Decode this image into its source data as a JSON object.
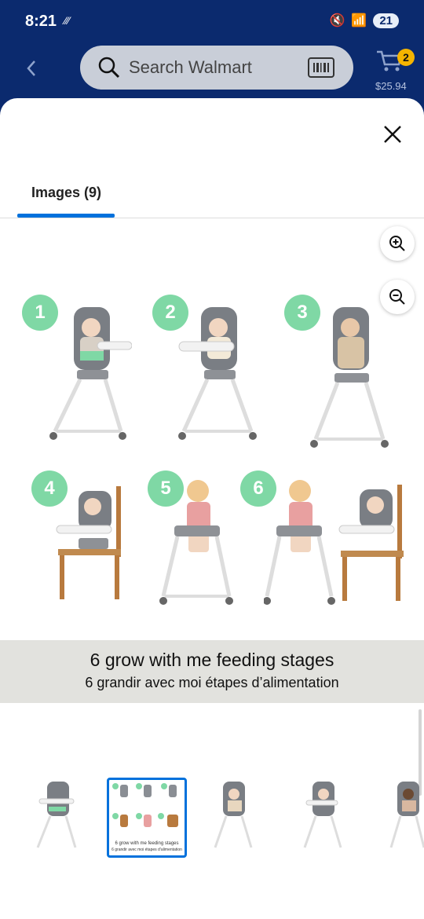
{
  "status_bar": {
    "time": "8:21",
    "battery": "21"
  },
  "search": {
    "placeholder": "Search Walmart"
  },
  "cart": {
    "count": "2",
    "total": "$25.94"
  },
  "tabs": [
    {
      "label": "Images (9)"
    }
  ],
  "stages": [
    "1",
    "2",
    "3",
    "4",
    "5",
    "6"
  ],
  "caption": {
    "line1": "6 grow with me feeding stages",
    "line2": "6 grandir avec moi étapes d’alimentation"
  },
  "thumbnails": {
    "selected_index": 1,
    "selected_caption_1": "6 grow with me feeding stages",
    "selected_caption_2": "6 grandir avec moi étapes d’alimentation"
  },
  "icons": [
    "back-chevron-icon",
    "search-icon",
    "barcode-icon",
    "cart-icon",
    "close-icon",
    "zoom-in-icon",
    "zoom-out-icon"
  ],
  "colors": {
    "header_bg": "#0b2a6e",
    "accent": "#0071dc",
    "badge": "#f5b400",
    "stage_green": "#7fd8a5"
  }
}
